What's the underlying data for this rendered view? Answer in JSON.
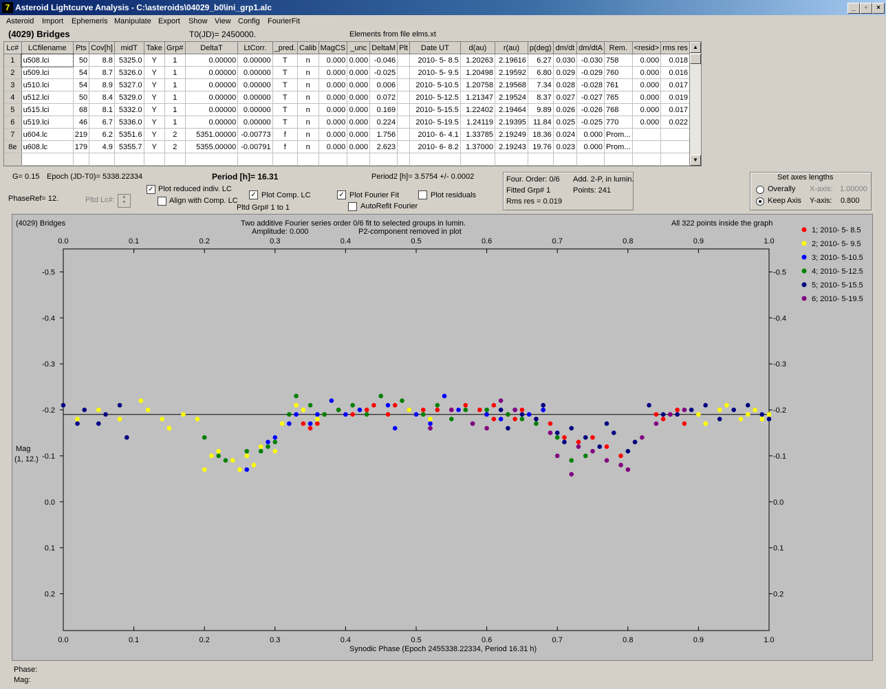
{
  "window": {
    "title": "Asteroid Lightcurve Analysis - C:\\asteroids\\04029_b0\\ini_grp1.alc",
    "min": "_",
    "max": "▫",
    "close": "×"
  },
  "menu": [
    "Asteroid",
    "Import",
    "Ephemeris",
    "Manipulate",
    "Export",
    "Show",
    "View",
    "Config",
    "FourierFit"
  ],
  "header": {
    "asteroid": "(4029) Bridges",
    "t0": "T0(JD)= 2450000.",
    "elements": "Elements from file elms.xt"
  },
  "table": {
    "columns": [
      "Lc#",
      "LCfilename",
      "Pts",
      "Cov[h]",
      "midT",
      "Take",
      "Grp#",
      "DeltaT",
      "LtCorr.",
      "_pred.",
      "Calib",
      "MagCS",
      "_unc",
      "DeltaM",
      "Plt",
      "Date UT",
      "d(au)",
      "r(au)",
      "p(deg)",
      "dm/dt",
      "dm/dtA",
      "Rem.",
      "<resid>",
      "rms res"
    ],
    "rows": [
      [
        "1",
        "u508.lci",
        "50",
        "8.8",
        "5325.0",
        "Y",
        "1",
        "0.00000",
        "0.00000",
        "T",
        "n",
        "0.000",
        "0.000",
        "-0.046",
        "",
        "2010- 5- 8.5",
        "1.20263",
        "2.19616",
        "6.27",
        "0.030",
        "-0.030",
        "758",
        "0.000",
        "0.018"
      ],
      [
        "2",
        "u509.lci",
        "54",
        "8.7",
        "5326.0",
        "Y",
        "1",
        "0.00000",
        "0.00000",
        "T",
        "n",
        "0.000",
        "0.000",
        "-0.025",
        "",
        "2010- 5- 9.5",
        "1.20498",
        "2.19592",
        "6.80",
        "0.029",
        "-0.029",
        "760",
        "0.000",
        "0.016"
      ],
      [
        "3",
        "u510.lci",
        "54",
        "8.9",
        "5327.0",
        "Y",
        "1",
        "0.00000",
        "0.00000",
        "T",
        "n",
        "0.000",
        "0.000",
        "0.006",
        "",
        "2010- 5-10.5",
        "1.20758",
        "2.19568",
        "7.34",
        "0.028",
        "-0.028",
        "761",
        "0.000",
        "0.017"
      ],
      [
        "4",
        "u512.lci",
        "50",
        "8.4",
        "5329.0",
        "Y",
        "1",
        "0.00000",
        "0.00000",
        "T",
        "n",
        "0.000",
        "0.000",
        "0.072",
        "",
        "2010- 5-12.5",
        "1.21347",
        "2.19524",
        "8.37",
        "0.027",
        "-0.027",
        "765",
        "0.000",
        "0.019"
      ],
      [
        "5",
        "u515.lci",
        "68",
        "8.1",
        "5332.0",
        "Y",
        "1",
        "0.00000",
        "0.00000",
        "T",
        "n",
        "0.000",
        "0.000",
        "0.169",
        "",
        "2010- 5-15.5",
        "1.22402",
        "2.19464",
        "9.89",
        "0.026",
        "-0.026",
        "768",
        "0.000",
        "0.017"
      ],
      [
        "6",
        "u519.lci",
        "46",
        "6.7",
        "5336.0",
        "Y",
        "1",
        "0.00000",
        "0.00000",
        "T",
        "n",
        "0.000",
        "0.000",
        "0.224",
        "",
        "2010- 5-19.5",
        "1.24119",
        "2.19395",
        "11.84",
        "0.025",
        "-0.025",
        "770",
        "0.000",
        "0.022"
      ],
      [
        "7",
        "u604.lc",
        "219",
        "6.2",
        "5351.6",
        "Y",
        "2",
        "5351.00000",
        "-0.00773",
        "f",
        "n",
        "0.000",
        "0.000",
        "1.756",
        "",
        "2010- 6- 4.1",
        "1.33785",
        "2.19249",
        "18.36",
        "0.024",
        "0.000",
        "Prom...",
        "",
        ""
      ],
      [
        "8e",
        "u608.lc",
        "179",
        "4.9",
        "5355.7",
        "Y",
        "2",
        "5355.00000",
        "-0.00791",
        "f",
        "n",
        "0.000",
        "0.000",
        "2.623",
        "",
        "2010- 6- 8.2",
        "1.37000",
        "2.19243",
        "19.76",
        "0.023",
        "0.000",
        "Prom...",
        "",
        ""
      ]
    ]
  },
  "controls": {
    "g": "G= 0.15",
    "epoch": "Epoch (JD-T0)= 5338.22334",
    "period": "Period [h]= 16.31",
    "period2": "Period2 [h]= 3.5754 +/- 0.0002",
    "phaseref": "PhaseRef= 12.",
    "pltd_lc": "Pltd Lc#:",
    "plot_reduced": "Plot reduced indiv. LC",
    "align_comp": "Align with Comp. LC",
    "plot_comp": "Plot Comp. LC",
    "pltd_grp": "Pltd Grp#  1   to   1",
    "plot_fourier": "Plot Fourier Fit",
    "autorefit": "AutoRefit Fourier",
    "plot_residuals": "Plot residuals"
  },
  "fourier_info": {
    "order": "Four. Order:  0/6",
    "add": "Add. 2-P, in lumin.",
    "fitted": "Fitted Grp# 1",
    "points": "Points: 241",
    "rms": "Rms res     = 0.019"
  },
  "axes_box": {
    "title": "Set axes lengths",
    "overally": "Overally",
    "keep": "Keep Axis",
    "xaxis_label": "X-axis:",
    "xaxis_val": "1.00000",
    "yaxis_label": "Y-axis:",
    "yaxis_val": "0.800"
  },
  "plot": {
    "title_left": "(4029) Bridges",
    "title_center1": "Two additive Fourier series order 0/6 fit to selected groups in lumin.",
    "title_center2": "Amplitude: 0.000",
    "title_center3": "P2-component removed in plot",
    "title_right": "All 322 points inside the graph",
    "ylabel1": "Mag",
    "ylabel2": "(1, 12.)",
    "xlabel": "Synodic Phase (Epoch 2455338.22334, Period 16.31 h)"
  },
  "status": {
    "phase": "Phase:",
    "mag": "Mag:"
  },
  "chart_data": {
    "type": "scatter",
    "xlim": [
      0.0,
      1.0
    ],
    "ylim": [
      -0.55,
      0.28
    ],
    "x_ticks": [
      "0.0",
      "0.1",
      "0.2",
      "0.3",
      "0.4",
      "0.5",
      "0.6",
      "0.7",
      "0.8",
      "0.9",
      "1.0"
    ],
    "y_ticks": [
      "-0.5",
      "-0.4",
      "-0.3",
      "-0.2",
      "-0.1",
      "0.0",
      "0.1",
      "0.2"
    ],
    "fit_line_y": -0.19,
    "legend_position": "right",
    "series": [
      {
        "name": "1; 2010- 5- 8.5",
        "color": "#ff0000",
        "points": [
          [
            0.34,
            -0.17
          ],
          [
            0.35,
            -0.16
          ],
          [
            0.36,
            -0.17
          ],
          [
            0.37,
            -0.19
          ],
          [
            0.39,
            -0.2
          ],
          [
            0.41,
            -0.19
          ],
          [
            0.43,
            -0.2
          ],
          [
            0.44,
            -0.21
          ],
          [
            0.46,
            -0.19
          ],
          [
            0.47,
            -0.21
          ],
          [
            0.49,
            -0.2
          ],
          [
            0.51,
            -0.2
          ],
          [
            0.53,
            -0.2
          ],
          [
            0.55,
            -0.2
          ],
          [
            0.57,
            -0.21
          ],
          [
            0.59,
            -0.2
          ],
          [
            0.61,
            -0.21
          ],
          [
            0.63,
            -0.19
          ],
          [
            0.65,
            -0.2
          ],
          [
            0.67,
            -0.18
          ],
          [
            0.69,
            -0.17
          ],
          [
            0.71,
            -0.14
          ],
          [
            0.73,
            -0.13
          ],
          [
            0.75,
            -0.14
          ],
          [
            0.77,
            -0.12
          ],
          [
            0.79,
            -0.1
          ],
          [
            0.81,
            -0.13
          ],
          [
            0.84,
            -0.19
          ],
          [
            0.85,
            -0.18
          ],
          [
            0.87,
            -0.2
          ],
          [
            0.88,
            -0.17
          ],
          [
            0.86,
            -0.19
          ],
          [
            0.61,
            -0.18
          ],
          [
            0.64,
            -0.18
          ],
          [
            0.6,
            -0.19
          ],
          [
            0.68,
            -0.2
          ]
        ]
      },
      {
        "name": "2; 2010- 5- 9.5",
        "color": "#ffff00",
        "points": [
          [
            0.02,
            -0.18
          ],
          [
            0.05,
            -0.2
          ],
          [
            0.06,
            -0.19
          ],
          [
            0.08,
            -0.18
          ],
          [
            0.11,
            -0.22
          ],
          [
            0.12,
            -0.2
          ],
          [
            0.14,
            -0.18
          ],
          [
            0.15,
            -0.16
          ],
          [
            0.17,
            -0.19
          ],
          [
            0.19,
            -0.18
          ],
          [
            0.2,
            -0.07
          ],
          [
            0.21,
            -0.1
          ],
          [
            0.22,
            -0.11
          ],
          [
            0.24,
            -0.09
          ],
          [
            0.25,
            -0.07
          ],
          [
            0.26,
            -0.1
          ],
          [
            0.27,
            -0.08
          ],
          [
            0.28,
            -0.12
          ],
          [
            0.3,
            -0.11
          ],
          [
            0.31,
            -0.17
          ],
          [
            0.33,
            -0.21
          ],
          [
            0.34,
            -0.2
          ],
          [
            0.36,
            -0.18
          ],
          [
            0.49,
            -0.2
          ],
          [
            0.52,
            -0.18
          ],
          [
            0.9,
            -0.19
          ],
          [
            0.91,
            -0.17
          ],
          [
            0.93,
            -0.2
          ],
          [
            0.94,
            -0.21
          ],
          [
            0.96,
            -0.18
          ],
          [
            0.97,
            -0.19
          ],
          [
            0.98,
            -0.2
          ],
          [
            0.99,
            -0.18
          ],
          [
            1.0,
            -0.19
          ]
        ]
      },
      {
        "name": "3; 2010- 5-10.5",
        "color": "#0000ff",
        "points": [
          [
            0.26,
            -0.07
          ],
          [
            0.29,
            -0.13
          ],
          [
            0.3,
            -0.14
          ],
          [
            0.32,
            -0.17
          ],
          [
            0.33,
            -0.19
          ],
          [
            0.35,
            -0.17
          ],
          [
            0.36,
            -0.19
          ],
          [
            0.38,
            -0.22
          ],
          [
            0.4,
            -0.19
          ],
          [
            0.42,
            -0.2
          ],
          [
            0.46,
            -0.21
          ],
          [
            0.47,
            -0.16
          ],
          [
            0.5,
            -0.19
          ],
          [
            0.52,
            -0.17
          ],
          [
            0.54,
            -0.23
          ],
          [
            0.56,
            -0.2
          ],
          [
            0.58,
            -0.17
          ],
          [
            0.6,
            -0.19
          ],
          [
            0.62,
            -0.18
          ],
          [
            0.64,
            -0.2
          ],
          [
            0.66,
            -0.19
          ],
          [
            0.68,
            -0.2
          ]
        ]
      },
      {
        "name": "4; 2010- 5-12.5",
        "color": "#008000",
        "points": [
          [
            0.2,
            -0.14
          ],
          [
            0.22,
            -0.1
          ],
          [
            0.23,
            -0.09
          ],
          [
            0.26,
            -0.11
          ],
          [
            0.28,
            -0.11
          ],
          [
            0.29,
            -0.12
          ],
          [
            0.3,
            -0.13
          ],
          [
            0.32,
            -0.19
          ],
          [
            0.33,
            -0.23
          ],
          [
            0.35,
            -0.21
          ],
          [
            0.37,
            -0.19
          ],
          [
            0.39,
            -0.2
          ],
          [
            0.41,
            -0.21
          ],
          [
            0.43,
            -0.19
          ],
          [
            0.45,
            -0.23
          ],
          [
            0.48,
            -0.22
          ],
          [
            0.51,
            -0.19
          ],
          [
            0.53,
            -0.21
          ],
          [
            0.55,
            -0.18
          ],
          [
            0.57,
            -0.2
          ],
          [
            0.6,
            -0.2
          ],
          [
            0.63,
            -0.19
          ],
          [
            0.65,
            -0.18
          ],
          [
            0.67,
            -0.17
          ],
          [
            0.7,
            -0.14
          ],
          [
            0.72,
            -0.09
          ],
          [
            0.74,
            -0.1
          ]
        ]
      },
      {
        "name": "5; 2010- 5-15.5",
        "color": "#000080",
        "points": [
          [
            0.0,
            -0.21
          ],
          [
            0.02,
            -0.17
          ],
          [
            0.03,
            -0.2
          ],
          [
            0.05,
            -0.17
          ],
          [
            0.06,
            -0.19
          ],
          [
            0.08,
            -0.21
          ],
          [
            0.09,
            -0.14
          ],
          [
            0.62,
            -0.2
          ],
          [
            0.63,
            -0.16
          ],
          [
            0.65,
            -0.19
          ],
          [
            0.67,
            -0.18
          ],
          [
            0.68,
            -0.21
          ],
          [
            0.7,
            -0.15
          ],
          [
            0.71,
            -0.13
          ],
          [
            0.72,
            -0.16
          ],
          [
            0.74,
            -0.14
          ],
          [
            0.76,
            -0.12
          ],
          [
            0.77,
            -0.17
          ],
          [
            0.78,
            -0.15
          ],
          [
            0.8,
            -0.11
          ],
          [
            0.81,
            -0.13
          ],
          [
            0.83,
            -0.21
          ],
          [
            0.85,
            -0.19
          ],
          [
            0.87,
            -0.19
          ],
          [
            0.89,
            -0.2
          ],
          [
            0.91,
            -0.21
          ],
          [
            0.93,
            -0.18
          ],
          [
            0.95,
            -0.2
          ],
          [
            0.97,
            -0.21
          ],
          [
            0.99,
            -0.19
          ],
          [
            1.0,
            -0.18
          ]
        ]
      },
      {
        "name": "6; 2010- 5-19.5",
        "color": "#800080",
        "points": [
          [
            0.52,
            -0.16
          ],
          [
            0.55,
            -0.2
          ],
          [
            0.58,
            -0.17
          ],
          [
            0.6,
            -0.16
          ],
          [
            0.62,
            -0.22
          ],
          [
            0.64,
            -0.2
          ],
          [
            0.69,
            -0.15
          ],
          [
            0.7,
            -0.1
          ],
          [
            0.72,
            -0.06
          ],
          [
            0.73,
            -0.12
          ],
          [
            0.75,
            -0.11
          ],
          [
            0.77,
            -0.09
          ],
          [
            0.79,
            -0.08
          ],
          [
            0.8,
            -0.07
          ],
          [
            0.82,
            -0.14
          ],
          [
            0.84,
            -0.17
          ],
          [
            0.86,
            -0.19
          ],
          [
            0.88,
            -0.2
          ]
        ]
      }
    ]
  }
}
